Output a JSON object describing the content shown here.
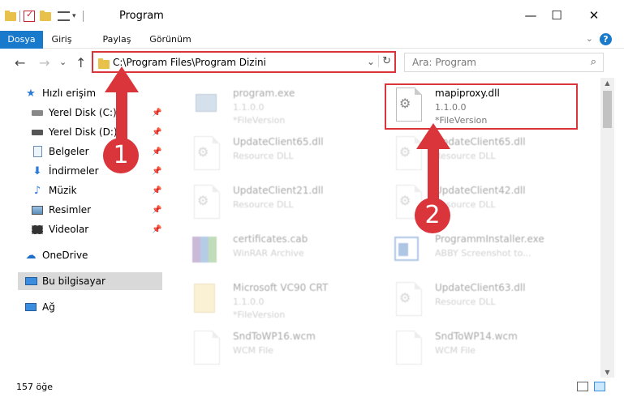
{
  "window": {
    "title": "Program",
    "minimize": "—",
    "maximize": "☐",
    "close": "✕"
  },
  "ribbon": {
    "tabs": [
      {
        "label": "Dosya",
        "active": true
      },
      {
        "label": "Giriş"
      },
      {
        "label": "Paylaş"
      },
      {
        "label": "Görünüm"
      }
    ],
    "expand": "⌄",
    "help": "?"
  },
  "nav": {
    "back": "←",
    "forward": "→",
    "recent": "⌄",
    "up": "↑"
  },
  "address": {
    "path": "C:\\Program Files\\Program Dizini",
    "dropdown": "⌄",
    "refresh": "↻"
  },
  "search": {
    "placeholder": "Ara: Program",
    "icon": "⌕"
  },
  "sidebar": {
    "items": [
      {
        "label": "Hızlı erişim",
        "icon": "star-icon"
      },
      {
        "label": "Yerel Disk (C:)",
        "icon": "drive-icon",
        "pinned": true
      },
      {
        "label": "Yerel Disk (D:)",
        "icon": "drive-icon",
        "pinned": true
      },
      {
        "label": "Belgeler",
        "icon": "documents-icon",
        "pinned": true
      },
      {
        "label": "İndirmeler",
        "icon": "download-icon",
        "pinned": true
      },
      {
        "label": "Müzik",
        "icon": "music-icon",
        "pinned": true
      },
      {
        "label": "Resimler",
        "icon": "pictures-icon",
        "pinned": true
      },
      {
        "label": "Videolar",
        "icon": "videos-icon",
        "pinned": true
      },
      {
        "label": "OneDrive",
        "icon": "cloud-icon"
      },
      {
        "label": "Bu bilgisayar",
        "icon": "computer-icon"
      },
      {
        "label": "Ağ",
        "icon": "network-icon"
      }
    ]
  },
  "files": [
    {
      "name": "program.exe",
      "line1": "1.1.0.0",
      "line2": "*FileVersion",
      "icon": "exe-icon"
    },
    {
      "name": "mapiproxy.dll",
      "line1": "1.1.0.0",
      "line2": "*FileVersion",
      "icon": "dll-icon"
    },
    {
      "name": "UpdateClient65.dll",
      "line1": "Resource DLL",
      "line2": "",
      "icon": "dll-icon"
    },
    {
      "name": "UpdateClient65.dll",
      "line1": "Resource DLL",
      "line2": "",
      "icon": "dll-icon"
    },
    {
      "name": "UpdateClient21.dll",
      "line1": "Resource DLL",
      "line2": "",
      "icon": "dll-icon"
    },
    {
      "name": "UpdateClient42.dll",
      "line1": "Resource DLL",
      "line2": "",
      "icon": "dll-icon"
    },
    {
      "name": "certificates.cab",
      "line1": "WinRAR Archive",
      "line2": "",
      "icon": "archive-icon"
    },
    {
      "name": "ProgrammInstaller.exe",
      "line1": "ABBY Screenshot to...",
      "line2": "",
      "icon": "installer-icon"
    },
    {
      "name": "Microsoft VC90 CRT",
      "line1": "1.1.0.0",
      "line2": "*FileVersion",
      "icon": "folder-file-icon"
    },
    {
      "name": "UpdateClient63.dll",
      "line1": "Resource DLL",
      "line2": "",
      "icon": "dll-icon"
    },
    {
      "name": "SndToWP16.wcm",
      "line1": "WCM File",
      "line2": "",
      "icon": "file-icon"
    },
    {
      "name": "SndToWP14.wcm",
      "line1": "WCM File",
      "line2": "",
      "icon": "file-icon"
    }
  ],
  "status": {
    "count": "157 öğe"
  },
  "annotations": {
    "step1": "1",
    "step2": "2",
    "color": "#d9353a"
  },
  "colors": {
    "accent": "#1979ca",
    "selected": "#cce8ff"
  }
}
